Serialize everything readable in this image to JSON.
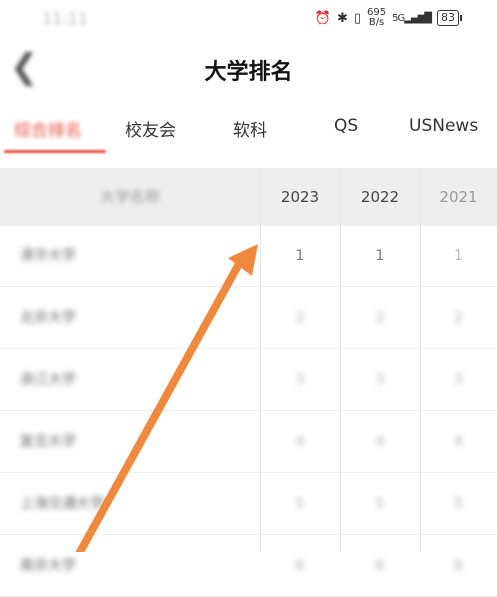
{
  "status_bar": {
    "time": "11:11",
    "net_speed_value": "695",
    "net_speed_unit": "B/s",
    "network": "5G",
    "battery": "83"
  },
  "header": {
    "back_glyph": "❮",
    "title": "大学排名"
  },
  "tabs": [
    {
      "label": "综合排名",
      "active": true
    },
    {
      "label": "校友会",
      "active": false
    },
    {
      "label": "软科",
      "active": false
    },
    {
      "label": "QS",
      "active": false
    },
    {
      "label": "USNews",
      "active": false
    }
  ],
  "table": {
    "headers": {
      "name": "大学名称",
      "y1": "2023",
      "y2": "2022",
      "y3": "2021"
    },
    "rows": [
      {
        "name": "清华大学",
        "y1": "1",
        "y2": "1",
        "y3": "1"
      },
      {
        "name": "北京大学",
        "y1": "2",
        "y2": "2",
        "y3": "2"
      },
      {
        "name": "浙江大学",
        "y1": "3",
        "y2": "3",
        "y3": "3"
      },
      {
        "name": "复旦大学",
        "y1": "4",
        "y2": "4",
        "y3": "4"
      },
      {
        "name": "上海交通大学",
        "y1": "5",
        "y2": "5",
        "y3": "5"
      },
      {
        "name": "南京大学",
        "y1": "6",
        "y2": "6",
        "y3": "6"
      }
    ]
  },
  "annotation": {
    "arrow_color": "#f0883e"
  },
  "colors": {
    "accent": "#e74c3c",
    "header_bg": "#eeeeee"
  }
}
